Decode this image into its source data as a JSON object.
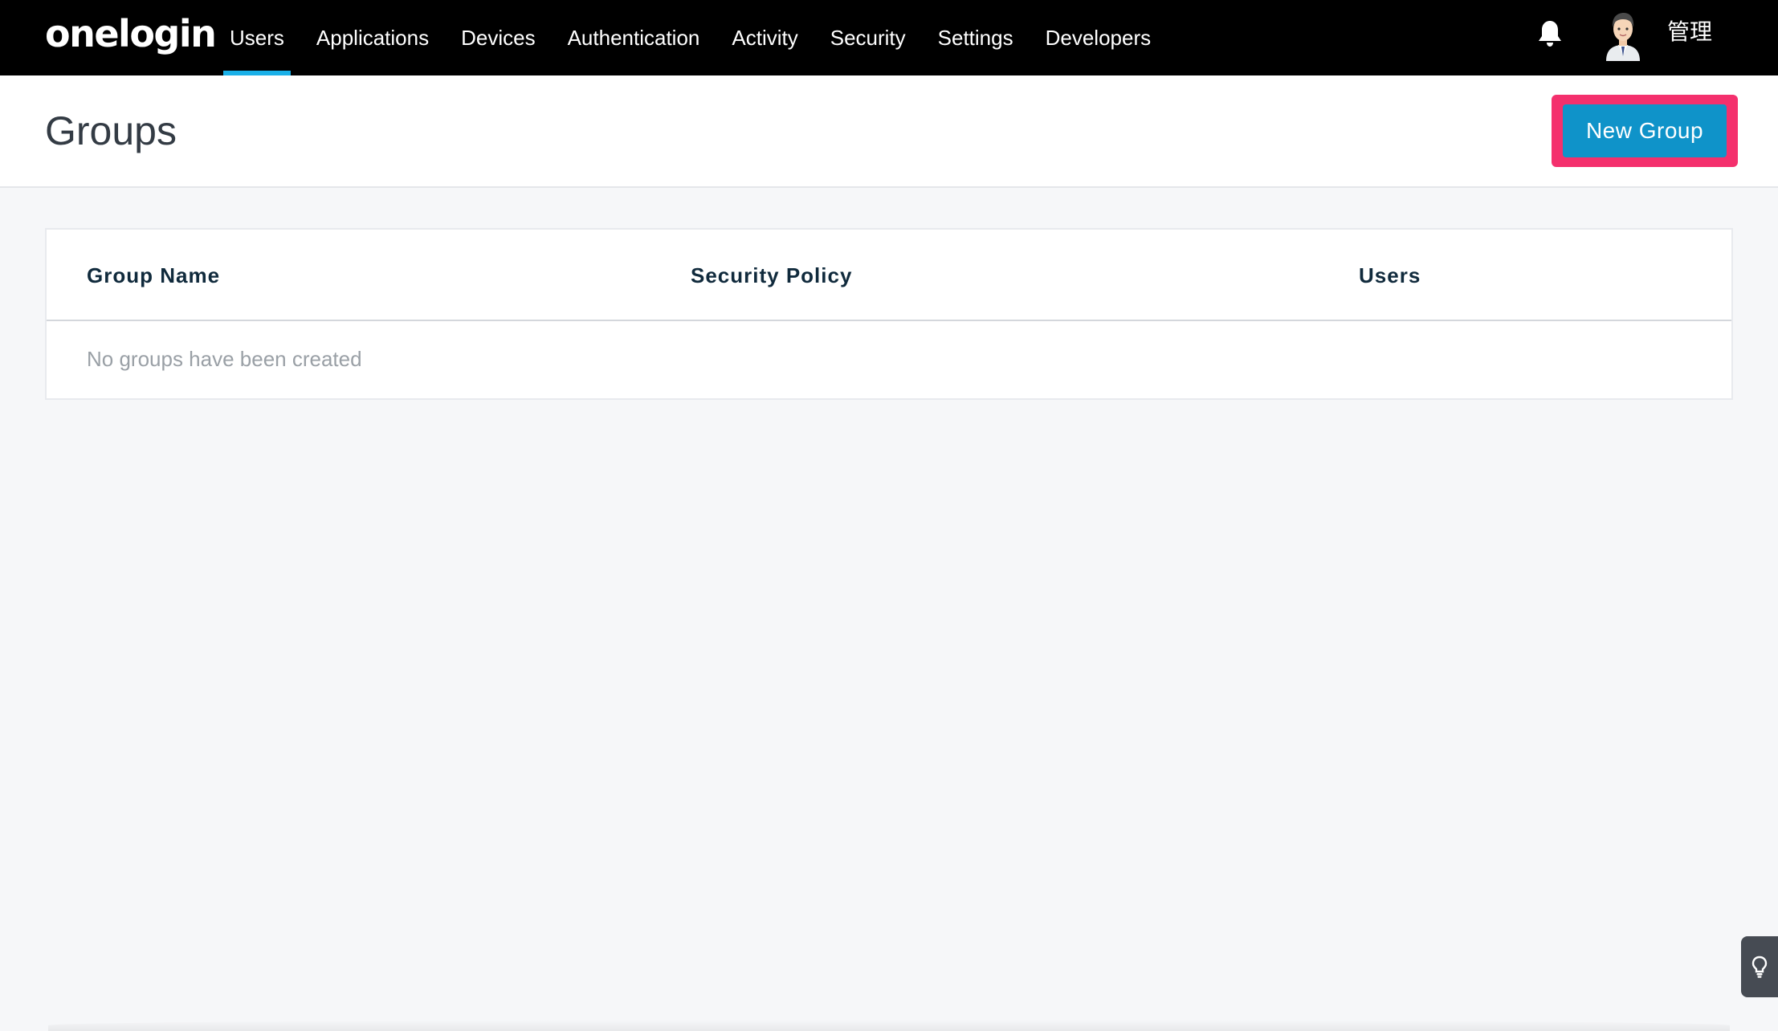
{
  "brand": {
    "logo_text": "onelogin"
  },
  "nav": {
    "items": [
      {
        "label": "Users",
        "active": true
      },
      {
        "label": "Applications",
        "active": false
      },
      {
        "label": "Devices",
        "active": false
      },
      {
        "label": "Authentication",
        "active": false
      },
      {
        "label": "Activity",
        "active": false
      },
      {
        "label": "Security",
        "active": false
      },
      {
        "label": "Settings",
        "active": false
      },
      {
        "label": "Developers",
        "active": false
      }
    ],
    "notification_icon": "bell-icon",
    "user": {
      "avatar_icon": "user-avatar",
      "name": "管理"
    }
  },
  "page": {
    "title": "Groups",
    "new_group_label": "New Group"
  },
  "table": {
    "columns": [
      "Group Name",
      "Security Policy",
      "Users"
    ],
    "empty_message": "No groups have been created"
  },
  "help": {
    "icon": "lightbulb-icon"
  },
  "colors": {
    "nav_bg": "#000000",
    "active_tab": "#1ab0e8",
    "primary_button": "#0f93c9",
    "highlight": "#f4306d"
  }
}
